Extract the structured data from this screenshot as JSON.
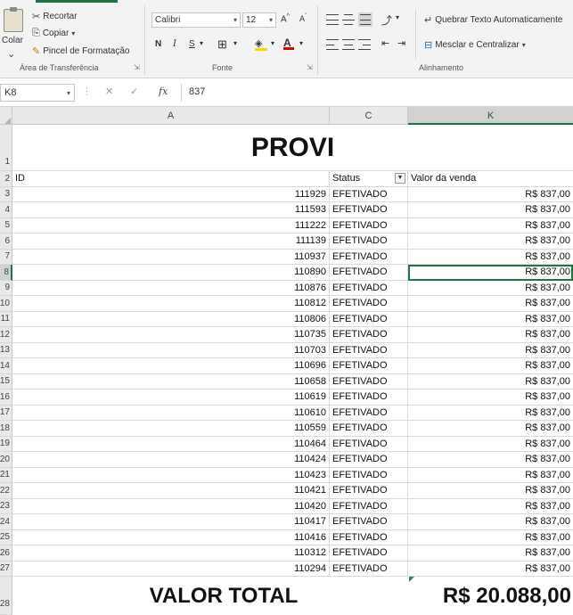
{
  "ribbon": {
    "clipboard": {
      "paste": "Colar",
      "cut": "Recortar",
      "copy": "Copiar",
      "format_painter": "Pincel de Formatação",
      "group_label": "Área de Transferência"
    },
    "font": {
      "font_name": "Calibri",
      "font_size": "12",
      "bold": "N",
      "italic": "I",
      "underline": "S",
      "group_label": "Fonte"
    },
    "alignment": {
      "wrap_text": "Quebrar Texto Automaticamente",
      "merge_center": "Mesclar e Centralizar",
      "group_label": "Alinhamento"
    }
  },
  "formula_bar": {
    "name_box": "K8",
    "fx": "fx",
    "value": "837"
  },
  "grid": {
    "columns": [
      "A",
      "C",
      "K"
    ],
    "selected_column": "K",
    "title": "PROVI",
    "headers": {
      "row": "2",
      "a": "ID",
      "c": "Status",
      "k": "Valor da venda"
    },
    "rows": [
      {
        "row": "3",
        "id": "111929",
        "status": "EFETIVADO",
        "valor": "R$ 837,00"
      },
      {
        "row": "4",
        "id": "111593",
        "status": "EFETIVADO",
        "valor": "R$ 837,00"
      },
      {
        "row": "5",
        "id": "111222",
        "status": "EFETIVADO",
        "valor": "R$ 837,00"
      },
      {
        "row": "6",
        "id": "111139",
        "status": "EFETIVADO",
        "valor": "R$ 837,00"
      },
      {
        "row": "7",
        "id": "110937",
        "status": "EFETIVADO",
        "valor": "R$ 837,00"
      },
      {
        "row": "8",
        "id": "110890",
        "status": "EFETIVADO",
        "valor": "R$ 837,00"
      },
      {
        "row": "9",
        "id": "110876",
        "status": "EFETIVADO",
        "valor": "R$ 837,00"
      },
      {
        "row": "10",
        "id": "110812",
        "status": "EFETIVADO",
        "valor": "R$ 837,00"
      },
      {
        "row": "11",
        "id": "110806",
        "status": "EFETIVADO",
        "valor": "R$ 837,00"
      },
      {
        "row": "12",
        "id": "110735",
        "status": "EFETIVADO",
        "valor": "R$ 837,00"
      },
      {
        "row": "13",
        "id": "110703",
        "status": "EFETIVADO",
        "valor": "R$ 837,00"
      },
      {
        "row": "14",
        "id": "110696",
        "status": "EFETIVADO",
        "valor": "R$ 837,00"
      },
      {
        "row": "15",
        "id": "110658",
        "status": "EFETIVADO",
        "valor": "R$ 837,00"
      },
      {
        "row": "16",
        "id": "110619",
        "status": "EFETIVADO",
        "valor": "R$ 837,00"
      },
      {
        "row": "17",
        "id": "110610",
        "status": "EFETIVADO",
        "valor": "R$ 837,00"
      },
      {
        "row": "18",
        "id": "110559",
        "status": "EFETIVADO",
        "valor": "R$ 837,00"
      },
      {
        "row": "19",
        "id": "110464",
        "status": "EFETIVADO",
        "valor": "R$ 837,00"
      },
      {
        "row": "20",
        "id": "110424",
        "status": "EFETIVADO",
        "valor": "R$ 837,00"
      },
      {
        "row": "21",
        "id": "110423",
        "status": "EFETIVADO",
        "valor": "R$ 837,00"
      },
      {
        "row": "22",
        "id": "110421",
        "status": "EFETIVADO",
        "valor": "R$ 837,00"
      },
      {
        "row": "23",
        "id": "110420",
        "status": "EFETIVADO",
        "valor": "R$ 837,00"
      },
      {
        "row": "24",
        "id": "110417",
        "status": "EFETIVADO",
        "valor": "R$ 837,00"
      },
      {
        "row": "25",
        "id": "110416",
        "status": "EFETIVADO",
        "valor": "R$ 837,00"
      },
      {
        "row": "26",
        "id": "110312",
        "status": "EFETIVADO",
        "valor": "R$ 837,00"
      },
      {
        "row": "27",
        "id": "110294",
        "status": "EFETIVADO",
        "valor": "R$ 837,00"
      }
    ],
    "title_row": "1",
    "total_row": "28",
    "total_label": "VALOR TOTAL",
    "total_value": "R$ 20.088,00",
    "selected_row": "8"
  },
  "colors": {
    "accent": "#217346",
    "ribbon_bg": "#f3f3f3",
    "header_bg": "#e9e9e9"
  }
}
